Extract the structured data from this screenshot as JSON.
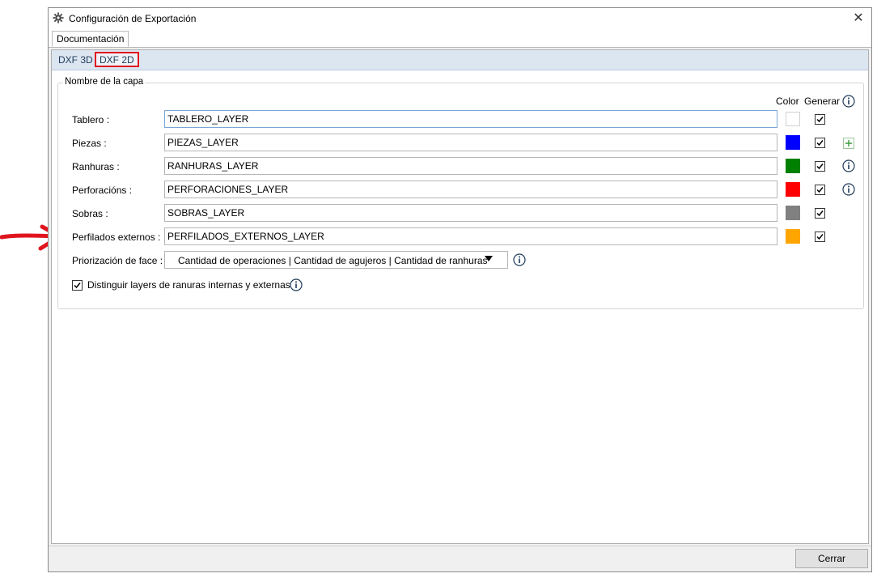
{
  "window": {
    "title": "Configuración de Exportación",
    "close_symbol": "✕"
  },
  "top_tabs": [
    {
      "label": "Documentación"
    }
  ],
  "sub_tabs": [
    {
      "label": "DXF 3D"
    },
    {
      "label": "DXF 2D"
    }
  ],
  "group": {
    "title": "Nombre de la capa",
    "col_color": "Color",
    "col_generar": "Generar"
  },
  "rows": [
    {
      "label": "Tablero :",
      "value": "TABLERO_LAYER",
      "color": "#ffffff",
      "generar": true
    },
    {
      "label": "Piezas :",
      "value": "PIEZAS_LAYER",
      "color": "#0000ff",
      "generar": true
    },
    {
      "label": "Ranhuras :",
      "value": "RANHURAS_LAYER",
      "color": "#008000",
      "generar": true
    },
    {
      "label": "Perforacións :",
      "value": "PERFORACIONES_LAYER",
      "color": "#ff0000",
      "generar": true
    },
    {
      "label": "Sobras :",
      "value": "SOBRAS_LAYER",
      "color": "#808080",
      "generar": true
    },
    {
      "label": "Perfilados externos :",
      "value": "PERFILADOS_EXTERNOS_LAYER",
      "color": "#ffa500",
      "generar": true
    }
  ],
  "priority": {
    "label": "Priorización de face :",
    "selected": "Cantidad de operaciones | Cantidad de agujeros | Cantidad de ranhuras"
  },
  "distinguish": {
    "label": "Distinguir layers de ranuras internas y externas",
    "checked": true
  },
  "footer": {
    "close_label": "Cerrar"
  },
  "colors": {
    "accent_highlight": "#e0141e",
    "subtab_bar": "#dce6f1"
  }
}
